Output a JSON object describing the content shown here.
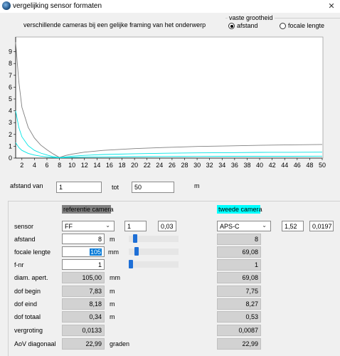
{
  "window": {
    "title": "vergelijking sensor formaten",
    "close_glyph": "✕"
  },
  "subtitle": "verschillende cameras bij een gelijke framing van het onderwerp",
  "fixed_quantity": {
    "label": "vaste grootheid",
    "options": [
      {
        "label": "afstand",
        "selected": true
      },
      {
        "label": "focale lengte",
        "selected": false
      }
    ]
  },
  "chart_data": {
    "type": "line",
    "x_ticks": [
      2,
      4,
      6,
      8,
      10,
      12,
      14,
      16,
      18,
      20,
      22,
      24,
      26,
      28,
      30,
      32,
      34,
      36,
      38,
      40,
      42,
      44,
      46,
      48,
      50
    ],
    "y_ticks": [
      0,
      1,
      2,
      3,
      4,
      5,
      6,
      7,
      8,
      9
    ],
    "xlim": [
      1,
      50
    ],
    "ylim": [
      0,
      10
    ],
    "grid": false,
    "series": [
      {
        "color": "#808080",
        "x": [
          1,
          1.5,
          2,
          3,
          4,
          5,
          6,
          7,
          8,
          9,
          10,
          12,
          15,
          20,
          25,
          30,
          35,
          40,
          45,
          50
        ],
        "y": [
          9.8,
          6.5,
          4.3,
          2.6,
          1.7,
          1.1,
          0.7,
          0.35,
          0.05,
          0.22,
          0.34,
          0.5,
          0.65,
          0.8,
          0.9,
          0.98,
          1.03,
          1.08,
          1.12,
          1.15
        ]
      },
      {
        "color": "#00e5e5",
        "x": [
          1,
          1.5,
          2,
          3,
          4,
          5,
          6,
          7,
          8,
          9,
          10,
          12,
          15,
          20,
          25,
          30,
          35,
          40,
          45,
          50
        ],
        "y": [
          4.0,
          2.6,
          1.8,
          1.05,
          0.65,
          0.42,
          0.26,
          0.12,
          0.03,
          0.1,
          0.16,
          0.23,
          0.3,
          0.37,
          0.41,
          0.44,
          0.46,
          0.48,
          0.49,
          0.5
        ]
      },
      {
        "color": "#00e5e5",
        "x": [
          1,
          1.5,
          2,
          3,
          4,
          5,
          6,
          7,
          8,
          9,
          10,
          12,
          15,
          20,
          25,
          30,
          35,
          40,
          45,
          50
        ],
        "y": [
          1.3,
          0.9,
          0.65,
          0.4,
          0.25,
          0.16,
          0.1,
          0.05,
          0.02,
          0.04,
          0.06,
          0.08,
          0.1,
          0.12,
          0.13,
          0.14,
          0.15,
          0.15,
          0.15,
          0.16
        ]
      }
    ]
  },
  "range": {
    "from_label": "afstand van",
    "from_value": "1",
    "to_label": "tot",
    "to_value": "50",
    "unit": "m"
  },
  "reference": {
    "header": "referentie camera",
    "sensor_label": "sensor",
    "sensor_value": "FF",
    "sensor_crop": "1",
    "sensor_coc": "0,03",
    "distance_label": "afstand",
    "distance_value": "8",
    "distance_unit": "m",
    "distance_slider": 0.09,
    "focal_label": "focale lengte",
    "focal_value": "105",
    "focal_unit": "mm",
    "focal_slider": 0.12,
    "fnr_label": "f-nr",
    "fnr_value": "1",
    "fnr_slider": 0.0,
    "aperture_label": "diam. apert.",
    "aperture_value": "105,00",
    "aperture_unit": "mm",
    "dof_begin_label": "dof begin",
    "dof_begin_value": "7,83",
    "dof_begin_unit": "m",
    "dof_end_label": "dof eind",
    "dof_end_value": "8,18",
    "dof_end_unit": "m",
    "dof_total_label": "dof totaal",
    "dof_total_value": "0,34",
    "dof_total_unit": "m",
    "magnification_label": "vergroting",
    "magnification_value": "0,0133",
    "aov_label": "AoV diagonaal",
    "aov_value": "22,99",
    "aov_unit": "graden"
  },
  "second": {
    "header": "tweede camera",
    "sensor_value": "APS-C",
    "sensor_crop": "1,52",
    "sensor_coc": "0,0197",
    "distance_value": "8",
    "focal_value": "69,08",
    "fnr_value": "1",
    "aperture_value": "69,08",
    "dof_begin_value": "7,75",
    "dof_end_value": "8,27",
    "dof_total_value": "0,53",
    "magnification_value": "0,0087",
    "aov_value": "22,99"
  }
}
